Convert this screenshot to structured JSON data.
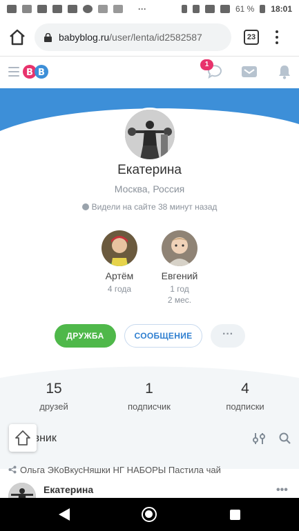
{
  "status_bar": {
    "battery": "61 %",
    "time": "18:01"
  },
  "browser": {
    "url_host": "babyblog.ru",
    "url_path": "/user/lenta/id2582587",
    "tab_count": "23"
  },
  "site_header": {
    "logo_text": "BB",
    "notifications_count": "1"
  },
  "profile": {
    "name": "Екатерина",
    "city": "Москва, Россия",
    "last_seen": "Видели на сайте 38 минут назад"
  },
  "kids": [
    {
      "name": "Артём",
      "age_line1": "4 года",
      "age_line2": ""
    },
    {
      "name": "Евгений",
      "age_line1": "1 год",
      "age_line2": "2 мес."
    }
  ],
  "actions": {
    "friend": "ДРУЖБА",
    "message": "СООБЩЕНИЕ",
    "more": "···"
  },
  "stats": [
    {
      "value": "15",
      "label": "друзей"
    },
    {
      "value": "1",
      "label": "подписчик"
    },
    {
      "value": "4",
      "label": "подписки"
    }
  ],
  "feed": {
    "title": "Дневник",
    "post": {
      "shared_from": "Ольга ЭКоВкусНяшки НГ НАБОРЫ Пастила чай",
      "author": "Екатерина",
      "more": "•••"
    }
  },
  "colors": {
    "cover_blue": "#3d8fd8",
    "friend_green": "#4fb84a",
    "accent_blue": "#2f7fd0",
    "badge_pink": "#e8336c"
  }
}
